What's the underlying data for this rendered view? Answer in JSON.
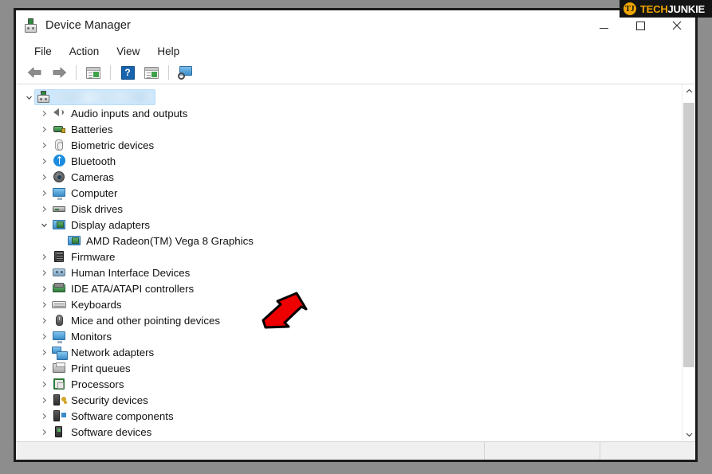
{
  "window": {
    "title": "Device Manager",
    "icon": "device-manager-icon",
    "controls": {
      "minimize": "—",
      "maximize": "☐",
      "close": "✕"
    }
  },
  "menubar": {
    "items": [
      {
        "label": "File",
        "name": "menu-file"
      },
      {
        "label": "Action",
        "name": "menu-action"
      },
      {
        "label": "View",
        "name": "menu-view"
      },
      {
        "label": "Help",
        "name": "menu-help"
      }
    ]
  },
  "toolbar": {
    "buttons": [
      {
        "name": "back-arrow-icon",
        "tip": "Back"
      },
      {
        "name": "forward-arrow-icon",
        "tip": "Forward"
      },
      {
        "name": "properties-icon",
        "tip": "Properties"
      },
      {
        "name": "help-icon",
        "tip": "Help",
        "glyph": "?"
      },
      {
        "name": "update-driver-icon",
        "tip": "Update driver"
      },
      {
        "name": "scan-hardware-changes-icon",
        "tip": "Scan for hardware changes"
      }
    ]
  },
  "tree": {
    "root": {
      "label": "",
      "redacted": true,
      "selected": true,
      "expanded": true,
      "icon": "computer-root-icon"
    },
    "nodes": [
      {
        "label": "Audio inputs and outputs",
        "icon": "speaker-icon",
        "expanded": false,
        "level": 1
      },
      {
        "label": "Batteries",
        "icon": "battery-icon",
        "expanded": false,
        "level": 1
      },
      {
        "label": "Biometric devices",
        "icon": "fingerprint-icon",
        "expanded": false,
        "level": 1
      },
      {
        "label": "Bluetooth",
        "icon": "bluetooth-icon",
        "expanded": false,
        "level": 1
      },
      {
        "label": "Cameras",
        "icon": "camera-icon",
        "expanded": false,
        "level": 1
      },
      {
        "label": "Computer",
        "icon": "monitor-icon",
        "expanded": false,
        "level": 1
      },
      {
        "label": "Disk drives",
        "icon": "disk-drive-icon",
        "expanded": false,
        "level": 1
      },
      {
        "label": "Display adapters",
        "icon": "display-adapter-icon",
        "expanded": true,
        "level": 1
      },
      {
        "label": "AMD Radeon(TM) Vega 8 Graphics",
        "icon": "display-adapter-icon",
        "expanded": null,
        "level": 2
      },
      {
        "label": "Firmware",
        "icon": "firmware-icon",
        "expanded": false,
        "level": 1
      },
      {
        "label": "Human Interface Devices",
        "icon": "hid-icon",
        "expanded": false,
        "level": 1
      },
      {
        "label": "IDE ATA/ATAPI controllers",
        "icon": "ide-controller-icon",
        "expanded": false,
        "level": 1
      },
      {
        "label": "Keyboards",
        "icon": "keyboard-icon",
        "expanded": false,
        "level": 1
      },
      {
        "label": "Mice and other pointing devices",
        "icon": "mouse-icon",
        "expanded": false,
        "level": 1
      },
      {
        "label": "Monitors",
        "icon": "monitor-icon",
        "expanded": false,
        "level": 1
      },
      {
        "label": "Network adapters",
        "icon": "network-adapter-icon",
        "expanded": false,
        "level": 1
      },
      {
        "label": "Print queues",
        "icon": "printer-icon",
        "expanded": false,
        "level": 1
      },
      {
        "label": "Processors",
        "icon": "processor-icon",
        "expanded": false,
        "level": 1
      },
      {
        "label": "Security devices",
        "icon": "security-device-icon",
        "expanded": false,
        "level": 1
      },
      {
        "label": "Software components",
        "icon": "software-component-icon",
        "expanded": false,
        "level": 1
      },
      {
        "label": "Software devices",
        "icon": "software-device-icon",
        "expanded": false,
        "level": 1
      }
    ]
  },
  "scrollbar": {
    "up": "▴",
    "down": "▾"
  },
  "statusbar": {
    "main": "",
    "pane2": "",
    "pane3": ""
  },
  "annotation": {
    "arrow": {
      "name": "red-pointer-arrow",
      "color": "#ee0000",
      "outline": "#000000",
      "points_to": "AMD Radeon(TM) Vega 8 Graphics"
    }
  },
  "watermark": {
    "logo": "TJ",
    "text_primary": "TECH",
    "text_secondary": "JUNKIE",
    "color_primary": "#f0a500",
    "color_secondary": "#ffffff",
    "background": "#141414"
  }
}
